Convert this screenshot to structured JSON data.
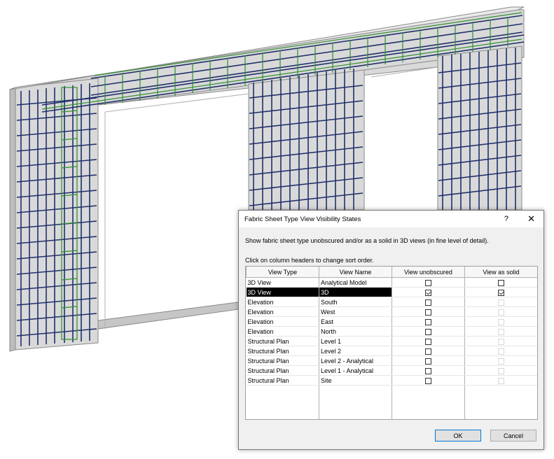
{
  "dialog": {
    "title": "Fabric Sheet Type View Visibility States",
    "help_label": "?",
    "close_label": "✕",
    "description": "Show fabric sheet type unobscured and/or as a solid in 3D views (in fine level of detail).",
    "sort_hint": "Click on column headers to change sort order.",
    "columns": [
      "View Type",
      "View Name",
      "View unobscured",
      "View as solid"
    ],
    "rows": [
      {
        "type": "3D View",
        "name": "Analytical Model",
        "unobscured": false,
        "solid": false,
        "solid_enabled": true,
        "selected": false
      },
      {
        "type": "3D View",
        "name": "3D",
        "unobscured": true,
        "solid": true,
        "solid_enabled": true,
        "selected": true
      },
      {
        "type": "Elevation",
        "name": "South",
        "unobscured": false,
        "solid": false,
        "solid_enabled": false,
        "selected": false
      },
      {
        "type": "Elevation",
        "name": "West",
        "unobscured": false,
        "solid": false,
        "solid_enabled": false,
        "selected": false
      },
      {
        "type": "Elevation",
        "name": "East",
        "unobscured": false,
        "solid": false,
        "solid_enabled": false,
        "selected": false
      },
      {
        "type": "Elevation",
        "name": "North",
        "unobscured": false,
        "solid": false,
        "solid_enabled": false,
        "selected": false
      },
      {
        "type": "Structural Plan",
        "name": "Level 1",
        "unobscured": false,
        "solid": false,
        "solid_enabled": false,
        "selected": false
      },
      {
        "type": "Structural Plan",
        "name": "Level 2",
        "unobscured": false,
        "solid": false,
        "solid_enabled": false,
        "selected": false
      },
      {
        "type": "Structural Plan",
        "name": "Level 2 - Analytical",
        "unobscured": false,
        "solid": false,
        "solid_enabled": false,
        "selected": false
      },
      {
        "type": "Structural Plan",
        "name": "Level 1 - Analytical",
        "unobscured": false,
        "solid": false,
        "solid_enabled": false,
        "selected": false
      },
      {
        "type": "Structural Plan",
        "name": "Site",
        "unobscured": false,
        "solid": false,
        "solid_enabled": false,
        "selected": false
      }
    ],
    "ok_label": "OK",
    "cancel_label": "Cancel"
  },
  "colors": {
    "rebar_dark": "#1f2f6b",
    "rebar_green": "#2f8f2f",
    "concrete": "#d4d4d4"
  }
}
